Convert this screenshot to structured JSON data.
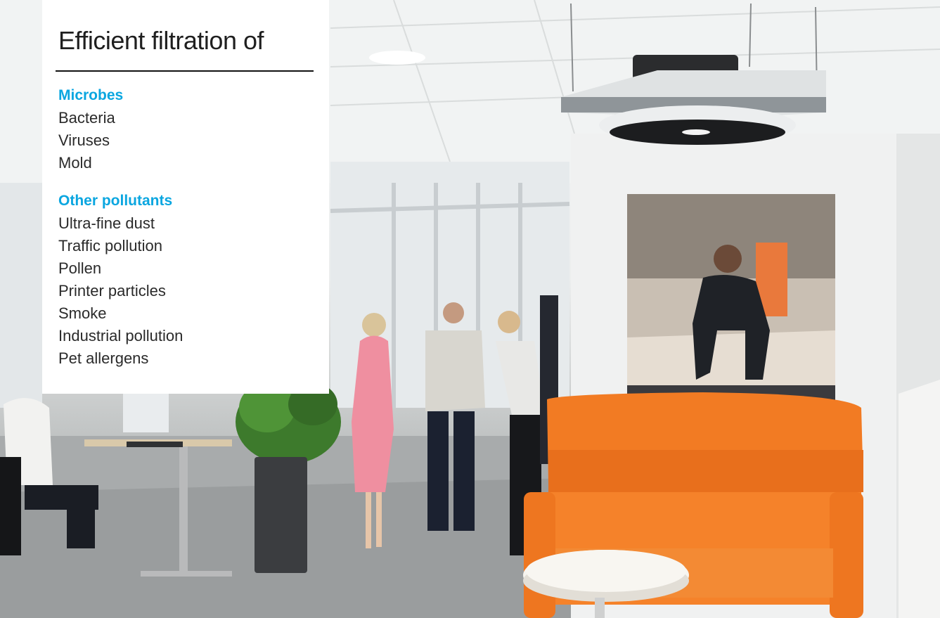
{
  "panel": {
    "title": "Efficient filtration of",
    "groups": [
      {
        "heading": "Microbes",
        "items": [
          "Bacteria",
          "Viruses",
          "Mold"
        ]
      },
      {
        "heading": "Other pollutants",
        "items": [
          "Ultra-fine dust",
          "Traffic pollution",
          "Pollen",
          "Printer particles",
          "Smoke",
          "Industrial pollution",
          "Pet allergens"
        ]
      }
    ]
  },
  "colors": {
    "heading_accent": "#0aa6e0",
    "sofa": "#f37a21",
    "panel_background": "#ffffff"
  },
  "scene_objects": [
    "ceiling-air-purifier",
    "wall-photo-print",
    "orange-sofa",
    "round-side-table",
    "potted-plant",
    "office-desks",
    "people-talking"
  ]
}
